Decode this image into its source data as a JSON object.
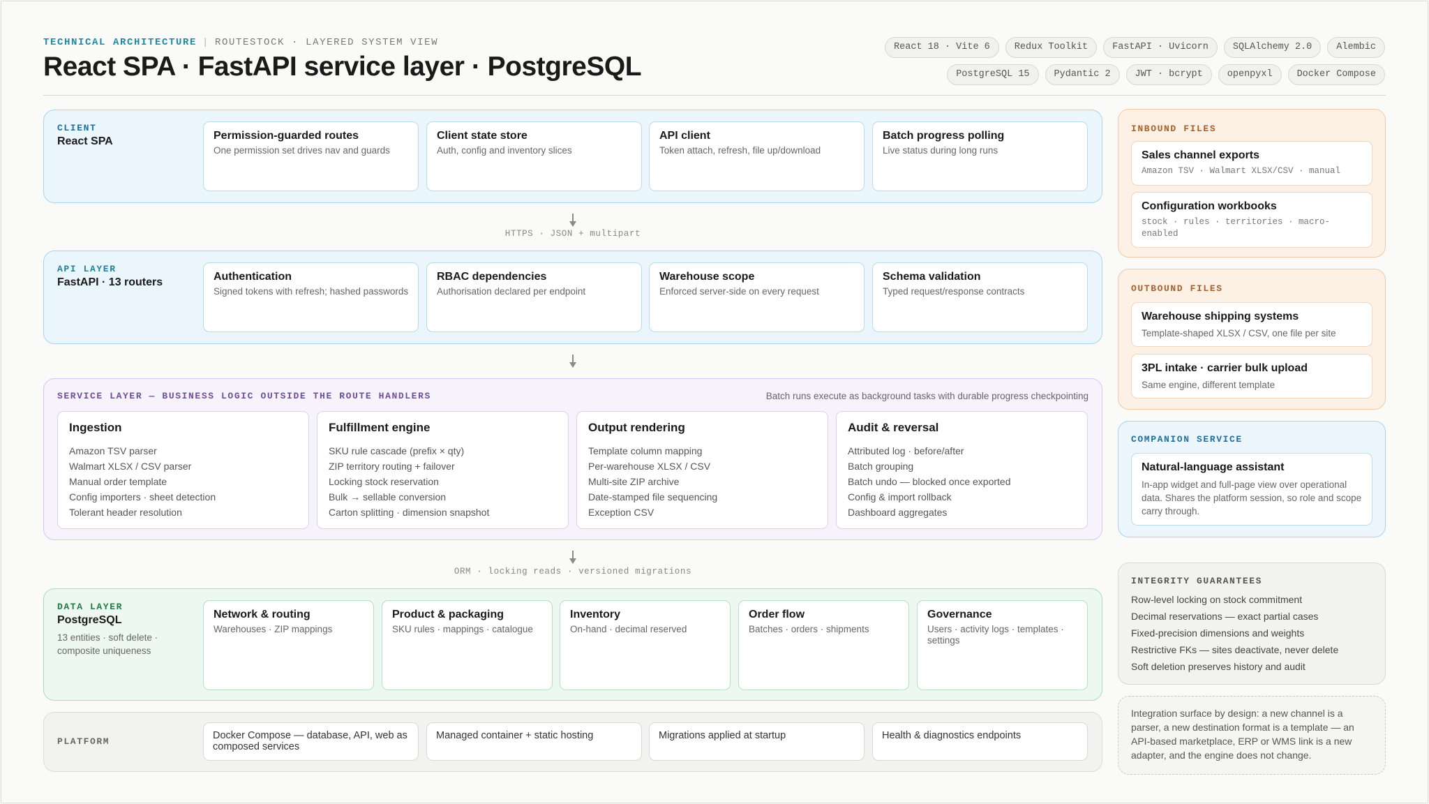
{
  "header": {
    "eyebrow_primary": "TECHNICAL ARCHITECTURE",
    "eyebrow_separator": "|",
    "eyebrow_secondary": "ROUTESTOCK · LAYERED SYSTEM VIEW",
    "title": "React SPA · FastAPI service layer · PostgreSQL",
    "chips": [
      "React 18 · Vite 6",
      "Redux Toolkit",
      "FastAPI · Uvicorn",
      "SQLAlchemy 2.0",
      "Alembic",
      "PostgreSQL 15",
      "Pydantic 2",
      "JWT · bcrypt",
      "openpyxl",
      "Docker Compose"
    ]
  },
  "client": {
    "kicker": "CLIENT",
    "name": "React SPA",
    "cards": [
      {
        "title": "Permission-guarded routes",
        "desc": "One permission set drives nav and guards"
      },
      {
        "title": "Client state store",
        "desc": "Auth, config and inventory slices"
      },
      {
        "title": "API client",
        "desc": "Token attach, refresh, file up/download"
      },
      {
        "title": "Batch progress polling",
        "desc": "Live status during long runs"
      }
    ]
  },
  "connector_client_api": "HTTPS · JSON + multipart",
  "api": {
    "kicker": "API LAYER",
    "name": "FastAPI · 13 routers",
    "cards": [
      {
        "title": "Authentication",
        "desc": "Signed tokens with refresh; hashed passwords"
      },
      {
        "title": "RBAC dependencies",
        "desc": "Authorisation declared per endpoint"
      },
      {
        "title": "Warehouse scope",
        "desc": "Enforced server-side on every request"
      },
      {
        "title": "Schema validation",
        "desc": "Typed request/response contracts"
      }
    ]
  },
  "service": {
    "kicker": "SERVICE LAYER — BUSINESS LOGIC OUTSIDE THE ROUTE HANDLERS",
    "note": "Batch runs execute as background tasks with durable progress checkpointing",
    "cards": [
      {
        "title": "Ingestion",
        "items": [
          "Amazon TSV parser",
          "Walmart XLSX / CSV parser",
          "Manual order template",
          "Config importers · sheet detection",
          "Tolerant header resolution"
        ]
      },
      {
        "title": "Fulfillment engine",
        "items": [
          "SKU rule cascade (prefix × qty)",
          "ZIP territory routing + failover",
          "Locking stock reservation",
          "Bulk → sellable conversion",
          "Carton splitting · dimension snapshot"
        ]
      },
      {
        "title": "Output rendering",
        "items": [
          "Template column mapping",
          "Per-warehouse XLSX / CSV",
          "Multi-site ZIP archive",
          "Date-stamped file sequencing",
          "Exception CSV"
        ]
      },
      {
        "title": "Audit & reversal",
        "items": [
          "Attributed log · before/after",
          "Batch grouping",
          "Batch undo — blocked once exported",
          "Config & import rollback",
          "Dashboard aggregates"
        ]
      }
    ]
  },
  "connector_service_data": "ORM · locking reads · versioned migrations",
  "data": {
    "kicker": "DATA LAYER",
    "name": "PostgreSQL",
    "sub": "13 entities · soft delete · composite uniqueness",
    "cards": [
      {
        "title": "Network & routing",
        "desc": "Warehouses · ZIP mappings"
      },
      {
        "title": "Product & packaging",
        "desc": "SKU rules · mappings · catalogue"
      },
      {
        "title": "Inventory",
        "desc": "On-hand · decimal reserved"
      },
      {
        "title": "Order flow",
        "desc": "Batches · orders · shipments"
      },
      {
        "title": "Governance",
        "desc": "Users · activity logs · templates · settings"
      }
    ]
  },
  "platform": {
    "kicker": "PLATFORM",
    "cards": [
      "Docker Compose — database, API, web as composed services",
      "Managed container + static hosting",
      "Migrations applied at startup",
      "Health & diagnostics endpoints"
    ]
  },
  "inbound": {
    "kicker": "INBOUND FILES",
    "cards": [
      {
        "title": "Sales channel exports",
        "desc": "Amazon TSV · Walmart XLSX/CSV · manual"
      },
      {
        "title": "Configuration workbooks",
        "desc": "stock · rules · territories · macro-enabled"
      }
    ]
  },
  "outbound": {
    "kicker": "OUTBOUND FILES",
    "cards": [
      {
        "title": "Warehouse shipping systems",
        "desc": "Template-shaped XLSX / CSV, one file per site"
      },
      {
        "title": "3PL intake · carrier bulk upload",
        "desc": "Same engine, different template"
      }
    ]
  },
  "companion": {
    "kicker": "COMPANION SERVICE",
    "card": {
      "title": "Natural-language assistant",
      "desc": "In-app widget and full-page view over operational data. Shares the platform session, so role and scope carry through."
    }
  },
  "integrity": {
    "kicker": "INTEGRITY GUARANTEES",
    "items": [
      "Row-level locking on stock commitment",
      "Decimal reservations — exact partial cases",
      "Fixed-precision dimensions and weights",
      "Restrictive FKs — sites deactivate, never delete",
      "Soft deletion preserves history and audit"
    ]
  },
  "note": "Integration surface by design: a new channel is a parser, a new destination format is a template — an API-based marketplace, ERP or WMS link is a new adapter, and the engine does not change.",
  "colors": {
    "accent_teal": "#1c8aa4",
    "client": "#1e6fa0",
    "service": "#6b4f9a",
    "data": "#1f7a44",
    "inbound": "#a8612b",
    "companion": "#1e6fa0"
  }
}
